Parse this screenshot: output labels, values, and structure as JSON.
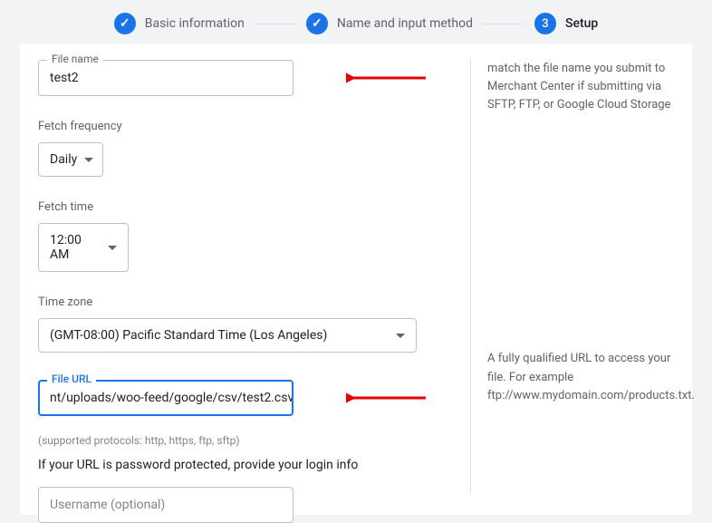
{
  "stepper": {
    "step1": "Basic information",
    "step2": "Name and input method",
    "step3_num": "3",
    "step3": "Setup"
  },
  "filename": {
    "label": "File name",
    "value": "test2"
  },
  "fetch_frequency": {
    "label": "Fetch frequency",
    "value": "Daily"
  },
  "fetch_time": {
    "label": "Fetch time",
    "value": "12:00 AM"
  },
  "timezone": {
    "label": "Time zone",
    "value": "(GMT-08:00) Pacific Standard Time (Los Angeles)"
  },
  "file_url": {
    "label": "File URL",
    "value": "nt/uploads/woo-feed/google/csv/test2.csv"
  },
  "hint_protocols": "(supported protocols: http, https, ftp, sftp)",
  "pw_note": "If your URL is password protected, provide your login info",
  "username": {
    "placeholder": "Username (optional)"
  },
  "side": {
    "filename_help": "match the file name you submit to Merchant Center if submitting via SFTP, FTP, or Google Cloud Storage",
    "fileurl_help": "A fully qualified URL to access your file. For example ftp://www.mydomain.com/products.txt."
  }
}
